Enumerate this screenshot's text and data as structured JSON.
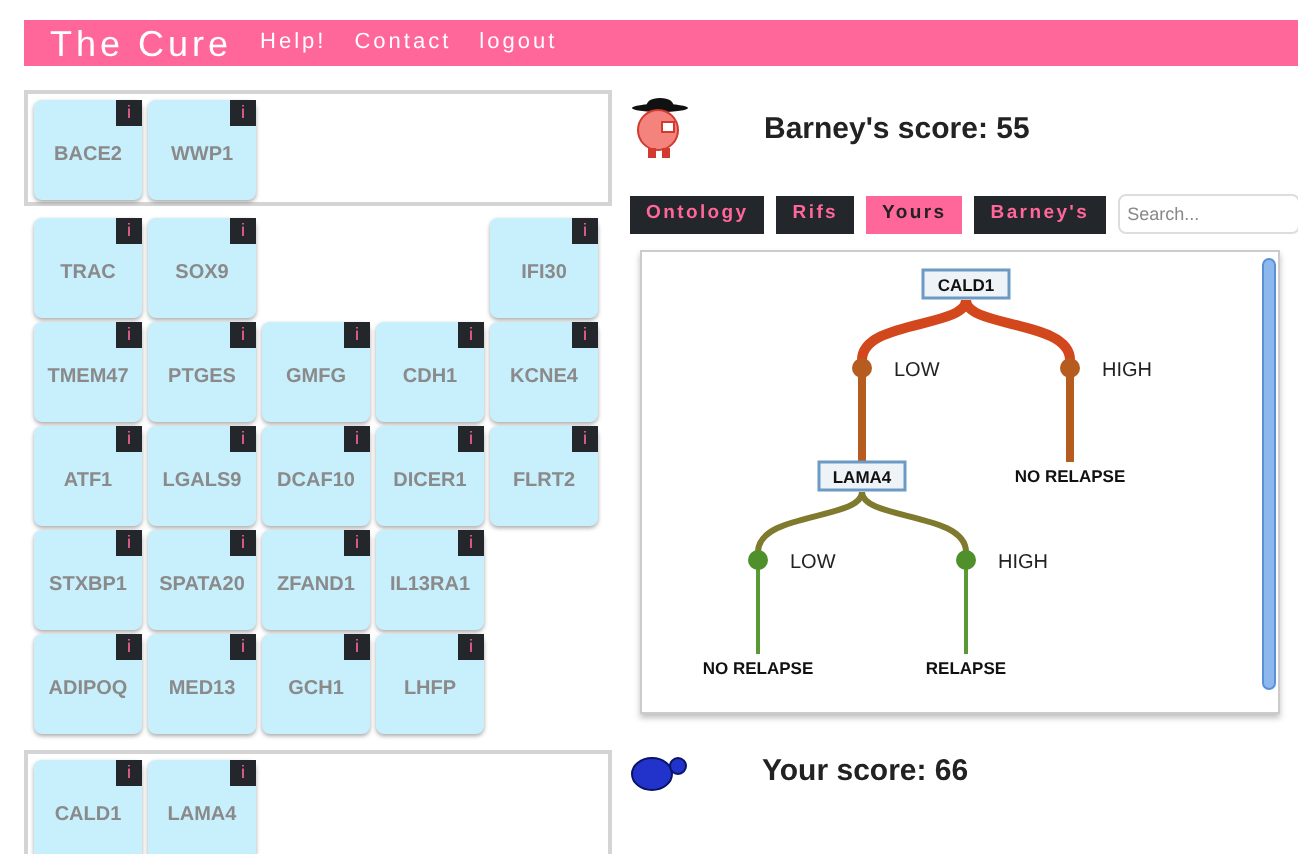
{
  "header": {
    "title": "The Cure",
    "links": [
      "Help!",
      "Contact",
      "logout"
    ]
  },
  "barney_hand": {
    "cards": [
      {
        "name": "BACE2",
        "badge": "i"
      },
      {
        "name": "WWP1",
        "badge": "i"
      }
    ]
  },
  "gene_grid": {
    "rows": [
      [
        {
          "kind": "gene",
          "name": "TRAC",
          "badge": "i"
        },
        {
          "kind": "gene",
          "name": "SOX9",
          "badge": "i"
        },
        {
          "kind": "blank"
        },
        {
          "kind": "blank"
        },
        {
          "kind": "gene",
          "name": "IFI30",
          "badge": "i"
        }
      ],
      [
        {
          "kind": "gene",
          "name": "TMEM47",
          "badge": "i"
        },
        {
          "kind": "gene",
          "name": "PTGES",
          "badge": "i"
        },
        {
          "kind": "gene",
          "name": "GMFG",
          "badge": "i"
        },
        {
          "kind": "gene",
          "name": "CDH1",
          "badge": "i"
        },
        {
          "kind": "gene",
          "name": "KCNE4",
          "badge": "i"
        }
      ],
      [
        {
          "kind": "gene",
          "name": "ATF1",
          "badge": "i"
        },
        {
          "kind": "gene",
          "name": "LGALS9",
          "badge": "i"
        },
        {
          "kind": "gene",
          "name": "DCAF10",
          "badge": "i"
        },
        {
          "kind": "gene",
          "name": "DICER1",
          "badge": "i"
        },
        {
          "kind": "gene",
          "name": "FLRT2",
          "badge": "i"
        }
      ],
      [
        {
          "kind": "gene",
          "name": "STXBP1",
          "badge": "i"
        },
        {
          "kind": "gene",
          "name": "SPATA20",
          "badge": "i"
        },
        {
          "kind": "gene",
          "name": "ZFAND1",
          "badge": "i"
        },
        {
          "kind": "gene",
          "name": "IL13RA1",
          "badge": "i"
        },
        {
          "kind": "blank"
        }
      ],
      [
        {
          "kind": "gene",
          "name": "ADIPOQ",
          "badge": "i"
        },
        {
          "kind": "gene",
          "name": "MED13",
          "badge": "i"
        },
        {
          "kind": "gene",
          "name": "GCH1",
          "badge": "i"
        },
        {
          "kind": "gene",
          "name": "LHFP",
          "badge": "i"
        },
        {
          "kind": "blank"
        }
      ]
    ]
  },
  "your_hand": {
    "cards": [
      {
        "name": "CALD1",
        "badge": "i"
      },
      {
        "name": "LAMA4",
        "badge": "i"
      }
    ]
  },
  "barney_score": "Barney's score: 55",
  "tabs": [
    {
      "label": "Ontology",
      "selected": false
    },
    {
      "label": "Rifs",
      "selected": false
    },
    {
      "label": "Yours",
      "selected": true
    },
    {
      "label": "Barney's",
      "selected": false
    }
  ],
  "search": {
    "placeholder": "Search..."
  },
  "tree": {
    "kind": "split",
    "label": "CALD1",
    "branches": [
      {
        "label": "LOW",
        "child": {
          "kind": "split",
          "label": "LAMA4",
          "branches": [
            {
              "label": "LOW",
              "child": {
                "kind": "leaf",
                "label": "NO RELAPSE"
              }
            },
            {
              "label": "HIGH",
              "child": {
                "kind": "leaf",
                "label": "RELAPSE"
              }
            }
          ]
        }
      },
      {
        "label": "HIGH",
        "child": {
          "kind": "leaf",
          "label": "NO RELAPSE"
        }
      }
    ]
  },
  "your_score": "Your score: 66"
}
